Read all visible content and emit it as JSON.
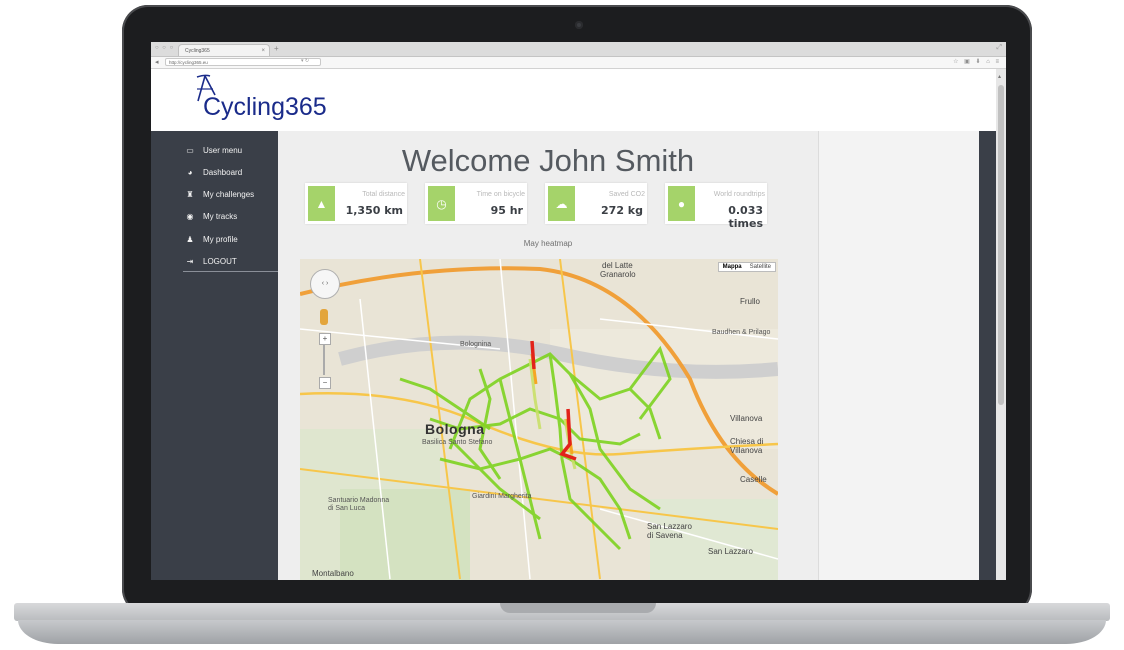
{
  "browser": {
    "tab_title": "Cycling365",
    "url": "http://cycling365.eu"
  },
  "logo": {
    "text_prefix": "Cycling",
    "text_suffix": "365"
  },
  "sidebar": {
    "items": [
      {
        "label": "User menu",
        "icon": "folder-icon"
      },
      {
        "label": "Dashboard",
        "icon": "dashboard-icon"
      },
      {
        "label": "My challenges",
        "icon": "trophy-icon"
      },
      {
        "label": "My tracks",
        "icon": "binoculars-icon"
      },
      {
        "label": "My profile",
        "icon": "user-icon"
      },
      {
        "label": "LOGOUT",
        "icon": "logout-icon"
      }
    ]
  },
  "main": {
    "welcome": "Welcome John Smith",
    "stats": [
      {
        "label": "Total distance",
        "value": "1,350 km",
        "icon": "road-icon"
      },
      {
        "label": "Time on bicycle",
        "value": "95 hr",
        "icon": "clock-icon"
      },
      {
        "label": "Saved CO2",
        "value": "272 kg",
        "icon": "cloud-icon"
      },
      {
        "label": "World roundtrips",
        "value": "0.033 times",
        "icon": "globe-icon"
      }
    ],
    "map_caption": "May heatmap"
  },
  "map": {
    "type_buttons": [
      "Mappa",
      "Satellite"
    ],
    "active_type": "Mappa",
    "labels": {
      "city": "Bologna",
      "latte": "del Latte",
      "granarolo": "Granarolo",
      "frullo": "Frullo",
      "baudo": "Baudhen & Prilago",
      "villanova": "Villanova",
      "chiesa": "Chiesa di",
      "chiesa2": "Villanova",
      "caselle": "Caselle",
      "basilica": "Basilica Santo Stefano",
      "giardini": "Giardini Margherita",
      "santuario": "Santuario Madonna",
      "santuario2": "di San Luca",
      "lazzaro": "San Lazzaro",
      "lazzaro2": "di Savena",
      "lazzaro3": "San Lazzaro",
      "montalbano": "Montalbano",
      "bolognina": "Bolognina"
    },
    "colors": {
      "low": "#7ed321",
      "mid": "#f5a623",
      "high": "#e2231a"
    }
  },
  "colors": {
    "sidebar": "#3a3f48",
    "accent": "#a5d36a",
    "logo": "#1a2b8a"
  }
}
